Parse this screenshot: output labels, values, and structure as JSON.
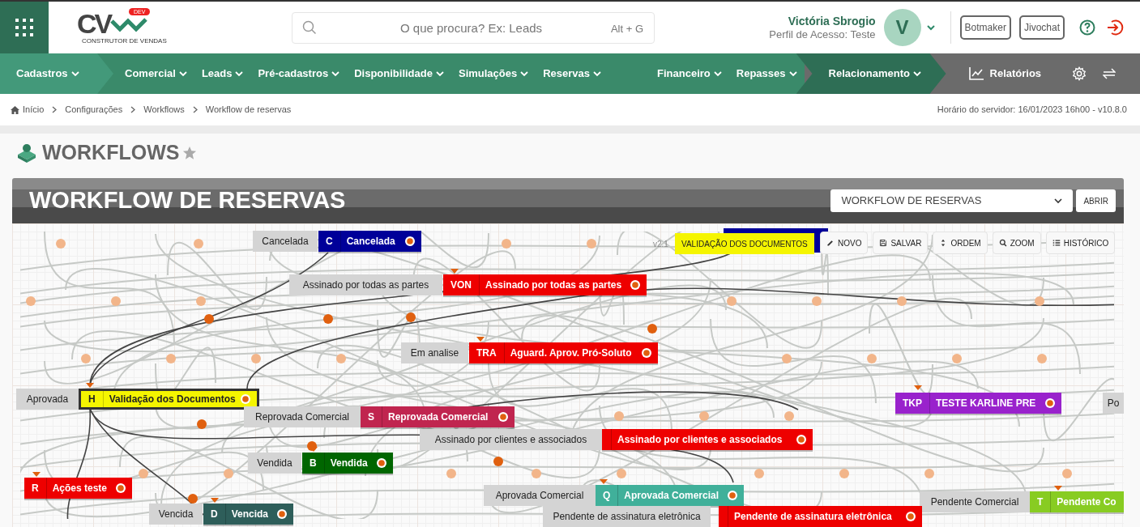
{
  "header": {
    "logo": {
      "letters": "CV",
      "badge": "DEV",
      "tagline": "CONSTRUTOR DE VENDAS"
    },
    "search": {
      "placeholder": "O que procura? Ex: Leads",
      "shortcut": "Alt + G"
    },
    "user": {
      "name": "Victória Sbrogio",
      "profile": "Perfil de Acesso: Teste",
      "avatar_letter": "V"
    },
    "buttons": [
      "Botmaker",
      "Jivochat"
    ]
  },
  "nav": [
    {
      "label": "Cadastros",
      "dropdown": true,
      "color": "#43997a"
    },
    {
      "label": "Comercial",
      "dropdown": true,
      "color": "#3a8a6a"
    },
    {
      "label": "Leads",
      "dropdown": true,
      "color": "#3a8a6a"
    },
    {
      "label": "Pré-cadastros",
      "dropdown": true,
      "color": "#3a8a6a"
    },
    {
      "label": "Disponibilidade",
      "dropdown": true,
      "color": "#3a8a6a"
    },
    {
      "label": "Simulações",
      "dropdown": true,
      "color": "#3a8a6a"
    },
    {
      "label": "Reservas",
      "dropdown": true,
      "color": "#3a8a6a"
    },
    {
      "label": "Financeiro",
      "dropdown": true,
      "color": "#3a8a6a"
    },
    {
      "label": "Repasses",
      "dropdown": true,
      "color": "#3a8a6a"
    },
    {
      "label": "Relacionamento",
      "dropdown": true,
      "color": "#2e6e55"
    },
    {
      "label": "Relatórios",
      "dropdown": false,
      "color": "#6b6b6b"
    }
  ],
  "breadcrumb": [
    "Início",
    "Configurações",
    "Workflows",
    "Workflow de reservas"
  ],
  "server_info": "Horário do servidor: 16/01/2023 16h00 - v10.8.0",
  "page_title": "WORKFLOWS",
  "workflow": {
    "title": "WORKFLOW DE RESERVAS",
    "select_value": "WORKFLOW DE RESERVAS",
    "open_button": "ABRIR",
    "version": "v2.1",
    "tooltip": "VALIDAÇÃO DOS DOCUMENTOS",
    "toolbar": [
      {
        "label": "NOVO",
        "kind": "new"
      },
      {
        "label": "SALVAR",
        "kind": "save"
      },
      {
        "label": "ORDEM",
        "kind": "order"
      },
      {
        "label": "ZOOM",
        "kind": "zoom"
      },
      {
        "label": "HISTÓRICO",
        "kind": "history"
      }
    ],
    "nodes": [
      {
        "label": "Cancelada",
        "code": "C",
        "name": "Cancelada",
        "color": "#000099",
        "selected": false
      },
      {
        "label": "Assinado por todas as partes",
        "code": "VON",
        "name": "Assinado por todas as partes",
        "color": "#ee0000",
        "selected": false
      },
      {
        "label": "Em analise",
        "code": "TRA",
        "name": "Aguard. Aprov. Pró-Soluto",
        "color": "#ee0000",
        "selected": false
      },
      {
        "label": "Aprovada",
        "code": "H",
        "name": "Validação dos Documentos",
        "color": "#f5f500",
        "selected": true
      },
      {
        "label": "Reprovada Comercial",
        "code": "S",
        "name": "Reprovada Comercial",
        "color": "#c0254f",
        "selected": false
      },
      {
        "label": "Assinado por clientes e associados",
        "name": "Assinado por clientes e associados",
        "color": "#ee0000",
        "selected": false
      },
      {
        "code": "TKP",
        "name": "TESTE KARLINE PRE",
        "color": "#9922cc",
        "selected": false
      },
      {
        "label": "Vendida",
        "code": "B",
        "name": "Vendida",
        "color": "#006600",
        "selected": false
      },
      {
        "code": "R",
        "name": "Ações teste",
        "color": "#ee0000",
        "selected": false
      },
      {
        "label": "Aprovada Comercial",
        "code": "Q",
        "name": "Aprovada Comercial",
        "color": "#40b09a",
        "selected": false
      },
      {
        "label": "Vencida",
        "code": "D",
        "name": "Vencida",
        "color": "#2e5e5a",
        "selected": false
      },
      {
        "label": "Pendente Comercial",
        "code": "T",
        "name": "Pendente Co",
        "color": "#88cc22",
        "selected": false
      },
      {
        "label": "Pendente de assinatura eletrônica",
        "name": "Pendente de assinatura eletrônica",
        "color": "#ee0000",
        "selected": false
      },
      {
        "label": "Po"
      }
    ]
  }
}
